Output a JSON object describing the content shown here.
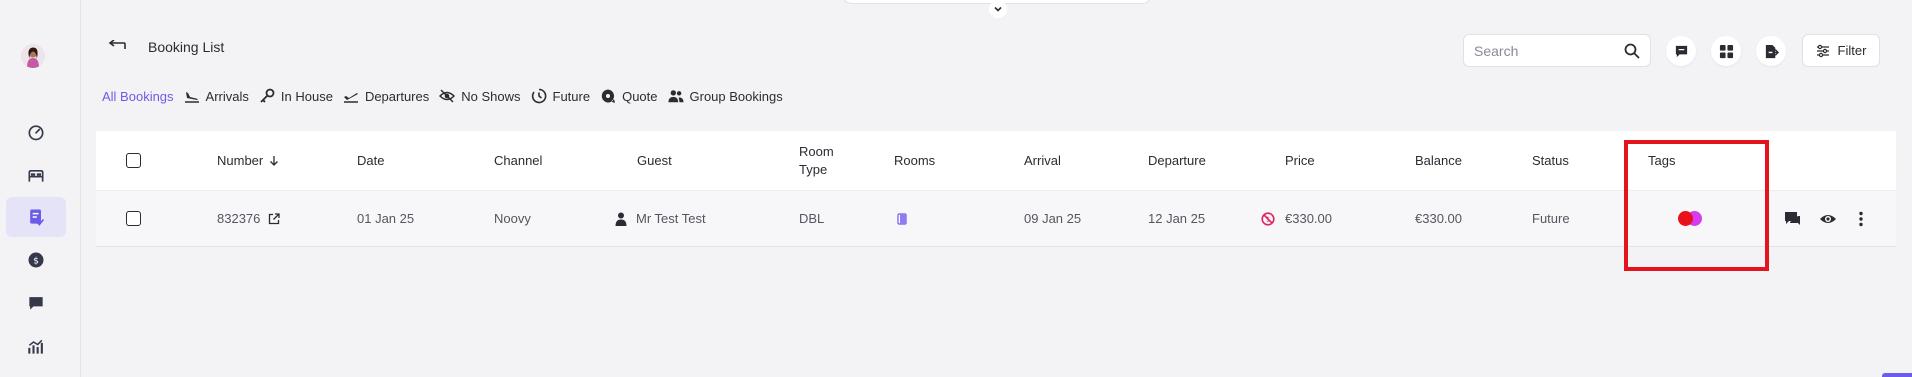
{
  "header": {
    "title": "Booking List",
    "back_icon": "arrow-left-icon"
  },
  "search": {
    "placeholder": "Search"
  },
  "toolbar": {
    "filter_label": "Filter"
  },
  "tabs": [
    {
      "label": "All Bookings",
      "icon": ""
    },
    {
      "label": "Arrivals",
      "icon": "plane-landing-icon"
    },
    {
      "label": "In House",
      "icon": "key-icon"
    },
    {
      "label": "Departures",
      "icon": "plane-takeoff-icon"
    },
    {
      "label": "No Shows",
      "icon": "eye-off-icon"
    },
    {
      "label": "Future",
      "icon": "clock-icon"
    },
    {
      "label": "Quote",
      "icon": "quote-icon"
    },
    {
      "label": "Group Bookings",
      "icon": "group-icon"
    }
  ],
  "columns": {
    "number": "Number",
    "date": "Date",
    "channel": "Channel",
    "guest": "Guest",
    "room_type_1": "Room",
    "room_type_2": "Type",
    "rooms": "Rooms",
    "arrival": "Arrival",
    "departure": "Departure",
    "price": "Price",
    "balance": "Balance",
    "status": "Status",
    "tags": "Tags"
  },
  "rows": [
    {
      "number": "832376",
      "date": "01 Jan 25",
      "channel": "Noovy",
      "guest": "Mr Test Test",
      "room_type": "DBL",
      "arrival": "09 Jan 25",
      "departure": "12 Jan 25",
      "price": "€330.00",
      "balance": "€330.00",
      "status": "Future",
      "tags": [
        "#e8121b",
        "#d53cf0"
      ]
    }
  ],
  "colors": {
    "accent": "#6c5ce7",
    "highlight": "#e3141b",
    "price_icon": "#e0245e"
  }
}
